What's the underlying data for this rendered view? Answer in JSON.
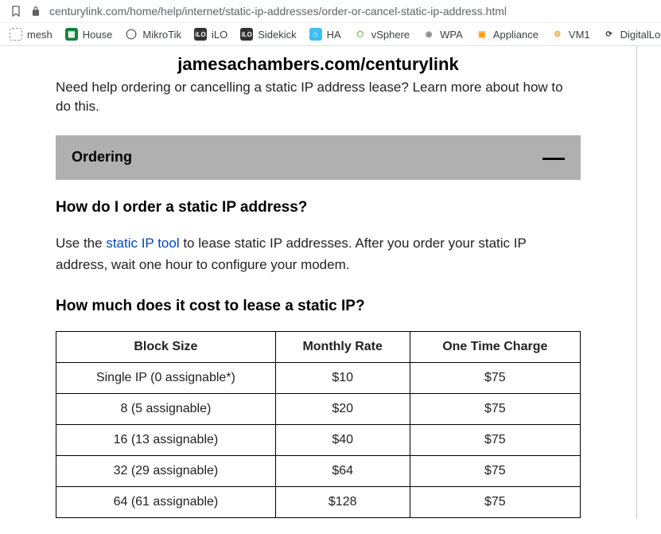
{
  "browser": {
    "url": "centurylink.com/home/help/internet/static-ip-addresses/order-or-cancel-static-ip-address.html",
    "bookmarks": [
      {
        "label": "mesh"
      },
      {
        "label": "House"
      },
      {
        "label": "MikroTik"
      },
      {
        "label": "iLO"
      },
      {
        "label": "Sidekick"
      },
      {
        "label": "HA"
      },
      {
        "label": "vSphere"
      },
      {
        "label": "WPA"
      },
      {
        "label": "Appliance"
      },
      {
        "label": "VM1"
      },
      {
        "label": "DigitalLoggers"
      }
    ]
  },
  "page": {
    "watermark": "jamesachambers.com/centurylink",
    "intro": "Need help ordering or cancelling a static IP address lease? Learn more about how to do this.",
    "accordion": {
      "title": "Ordering",
      "toggle": "—"
    },
    "section1_heading": "How do I order a static IP address?",
    "section1_text_pre": "Use the ",
    "section1_link": "static IP tool",
    "section1_text_post": " to lease static IP addresses. After you order your static IP address, wait one hour to configure your modem.",
    "section2_heading": "How much does it cost to lease a static IP?",
    "table": {
      "headers": [
        "Block Size",
        "Monthly Rate",
        "One Time Charge"
      ],
      "rows": [
        {
          "block": "Single IP (0 assignable*)",
          "monthly": "$10",
          "onetime": "$75"
        },
        {
          "block": "8 (5 assignable)",
          "monthly": "$20",
          "onetime": "$75"
        },
        {
          "block": "16 (13 assignable)",
          "monthly": "$40",
          "onetime": "$75"
        },
        {
          "block": "32 (29 assignable)",
          "monthly": "$64",
          "onetime": "$75"
        },
        {
          "block": "64 (61 assignable)",
          "monthly": "$128",
          "onetime": "$75"
        }
      ]
    }
  }
}
